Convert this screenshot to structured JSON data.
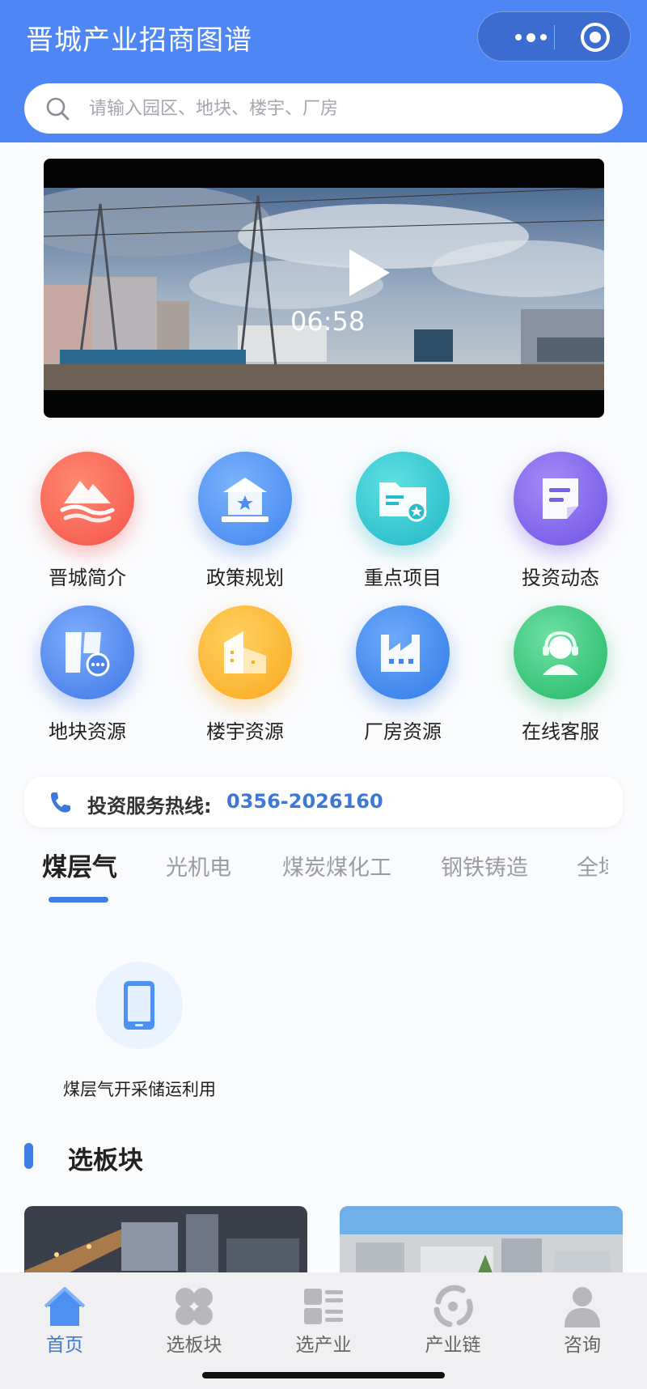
{
  "header": {
    "title": "晋城产业招商图谱",
    "search_placeholder": "请输入园区、地块、楼宇、厂房"
  },
  "video": {
    "duration": "06:58"
  },
  "grid": [
    {
      "label": "晋城简介",
      "icon": "mountain-icon",
      "color": "#ff6b5e"
    },
    {
      "label": "政策规划",
      "icon": "building-star-icon",
      "color": "#4f95f5"
    },
    {
      "label": "重点项目",
      "icon": "folder-star-icon",
      "color": "#2bc6cf"
    },
    {
      "label": "投资动态",
      "icon": "document-icon",
      "color": "#8a6ff0"
    },
    {
      "label": "地块资源",
      "icon": "land-plot-icon",
      "color": "#4b86ee"
    },
    {
      "label": "楼宇资源",
      "icon": "office-building-icon",
      "color": "#fdb630"
    },
    {
      "label": "厂房资源",
      "icon": "factory-icon",
      "color": "#3f8ef0"
    },
    {
      "label": "在线客服",
      "icon": "customer-service-icon",
      "color": "#37c77b"
    }
  ],
  "hotline": {
    "label": "投资服务热线:",
    "number": "0356-2026160"
  },
  "industry_tabs": [
    "煤层气",
    "光机电",
    "煤炭煤化工",
    "钢铁铸造",
    "全域"
  ],
  "sub_category": {
    "label": "煤层气开采储运利用",
    "icon": "phone-device-icon"
  },
  "section": {
    "title": "选板块"
  },
  "tabbar": [
    {
      "label": "首页",
      "icon": "home-icon",
      "active": true
    },
    {
      "label": "选板块",
      "icon": "clover-icon",
      "active": false
    },
    {
      "label": "选产业",
      "icon": "list-icon",
      "active": false
    },
    {
      "label": "产业链",
      "icon": "chain-icon",
      "active": false
    },
    {
      "label": "咨询",
      "icon": "person-icon",
      "active": false
    }
  ],
  "colors": {
    "brand": "#4f86f6",
    "accent": "#3f7fe4"
  }
}
